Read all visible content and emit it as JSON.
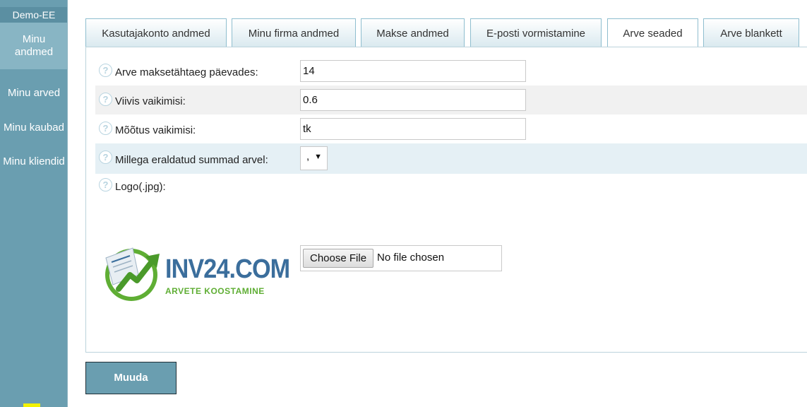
{
  "sidebar": {
    "brand": "Demo-EE",
    "items": [
      {
        "label_l1": "Minu",
        "label_l2": "andmed"
      },
      {
        "label": "Minu arved"
      },
      {
        "label": "Minu kaubad"
      },
      {
        "label": "Minu kliendid"
      }
    ]
  },
  "tabs": [
    {
      "label": "Kasutajakonto andmed"
    },
    {
      "label": "Minu firma andmed"
    },
    {
      "label": "Makse andmed"
    },
    {
      "label": "E-posti vormistamine"
    },
    {
      "label": "Arve seaded",
      "active": true
    },
    {
      "label": "Arve blankett"
    }
  ],
  "form": {
    "help_glyph": "?",
    "payment_term": {
      "label": "Arve maksetähtaeg päevades:",
      "value": "14"
    },
    "penalty": {
      "label": "Viivis vaikimisi:",
      "value": "0.6"
    },
    "unit": {
      "label": "Mõõtus vaikimisi:",
      "value": "tk"
    },
    "separator": {
      "label": "Millega eraldatud summad arvel:",
      "value": ",",
      "arrow": "▼"
    },
    "logo": {
      "label": "Logo(.jpg):",
      "choose_label": "Choose File",
      "status": "No file chosen"
    }
  },
  "logo_image": {
    "text": "INV24.COM",
    "subtext": "ARVETE KOOSTAMINE",
    "color_primary": "#3b6e9c",
    "color_accent": "#5fae34"
  },
  "actions": {
    "submit": "Muuda"
  },
  "colors": {
    "sidebar": "#6a9eb0",
    "tab_border": "#8fbecf",
    "row_shade": "#f1f1f1",
    "row_shade_blue": "#e5f0f5"
  }
}
